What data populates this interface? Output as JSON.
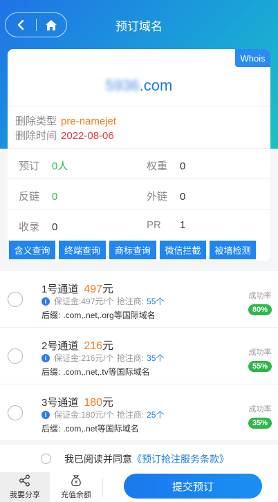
{
  "header": {
    "title": "预订域名"
  },
  "card": {
    "whois_label": "Whois",
    "domain_blurred": "5936",
    "domain_suffix": ".com",
    "delete_type_label": "删除类型",
    "delete_type_value": "pre-namejet",
    "delete_time_label": "删除时间",
    "delete_time_value": "2022-08-06",
    "stats": {
      "reserve_label": "预订",
      "reserve_value": "0人",
      "weight_label": "权重",
      "weight_value": "0",
      "backlink_label": "反链",
      "backlink_value": "0",
      "outlink_label": "外链",
      "outlink_value": "0",
      "indexed_label": "收录",
      "indexed_value": "0",
      "pr_label": "PR",
      "pr_value": "1"
    },
    "query_buttons": [
      "含义查询",
      "终端查询",
      "商标查询",
      "微信拦截",
      "被墙检测"
    ]
  },
  "channels": [
    {
      "name": "1号通道",
      "price": "497",
      "price_unit": "元",
      "deposit_label": "保证金:",
      "deposit": "497元/个",
      "rivals_label": "抢注商:",
      "rivals": "55个",
      "suffix_label": "后缀:",
      "suffix": ".com,.net,.org等国际域名",
      "rate_label": "成功率",
      "rate": "80%"
    },
    {
      "name": "2号通道",
      "price": "216",
      "price_unit": "元",
      "deposit_label": "保证金:",
      "deposit": "216元/个",
      "rivals_label": "抢注商:",
      "rivals": "35个",
      "suffix_label": "后缀:",
      "suffix": ".com,.net,.tv等国际域名",
      "rate_label": "成功率",
      "rate": "55%"
    },
    {
      "name": "3号通道",
      "price": "180",
      "price_unit": "元",
      "deposit_label": "保证金:",
      "deposit": "180元/个",
      "rivals_label": "抢注商:",
      "rivals": "25个",
      "suffix_label": "后缀:",
      "suffix": ".com,.net等国际域名",
      "rate_label": "成功率",
      "rate": "35%"
    }
  ],
  "agreement": {
    "text": "我已阅读并同意",
    "terms": "《预订抢注服务条款》"
  },
  "bottom_bar": {
    "share_label": "我要分享",
    "recharge_label": "充值余额",
    "submit_label": "提交预订"
  },
  "colors": {
    "primary": "#1f85f0",
    "orange": "#f07a1a",
    "red": "#e53935",
    "green": "#2fb74a"
  }
}
